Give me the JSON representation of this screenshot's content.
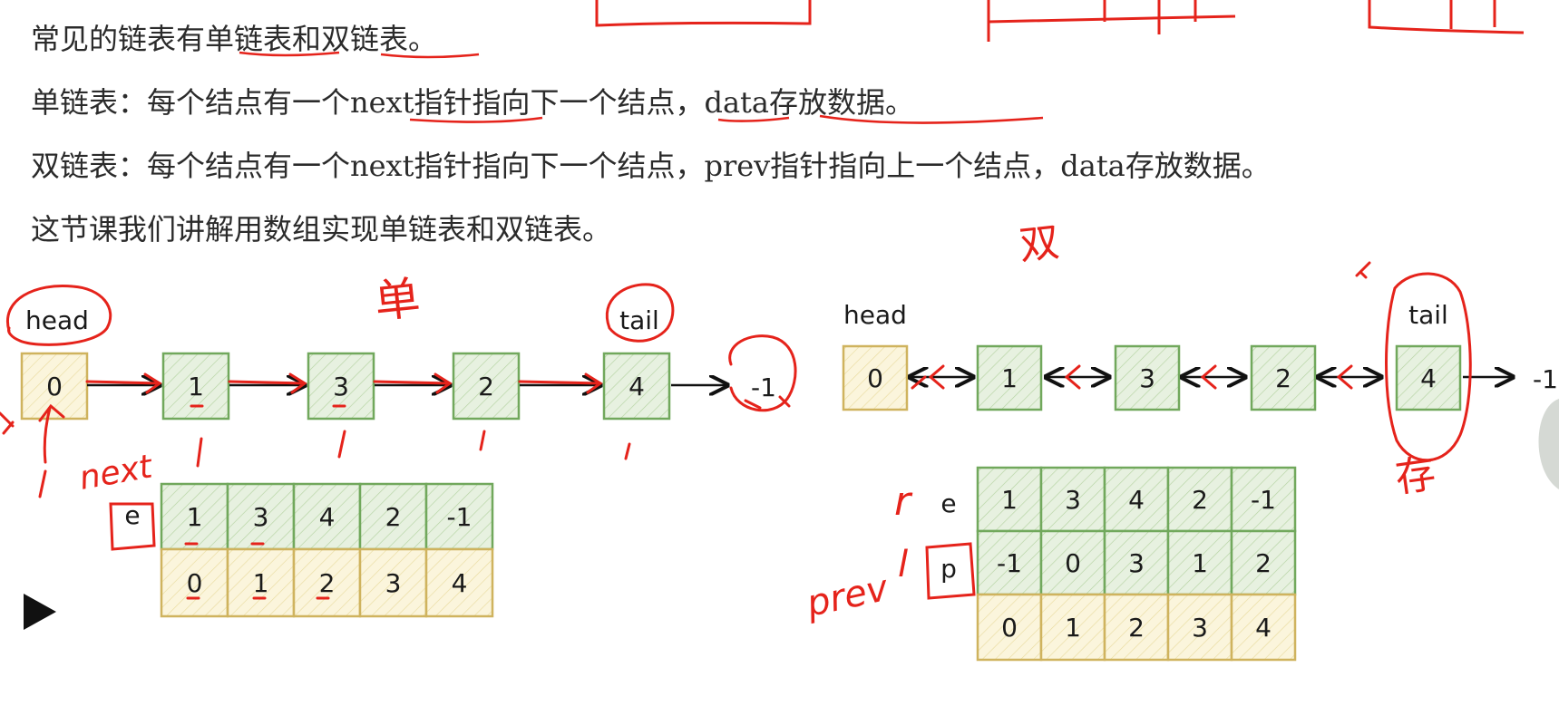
{
  "text_lines": [
    "常见的链表有单链表和双链表。",
    "单链表：每个结点有一个next指针指向下一个结点，data存放数据。",
    "双链表：每个结点有一个next指针指向下一个结点，prev指针指向上一个结点，data存放数据。",
    "这节课我们讲解用数组实现单链表和双链表。"
  ],
  "single_list": {
    "head_label": "head",
    "tail_label": "tail",
    "nodes": [
      "0",
      "1",
      "3",
      "2",
      "4"
    ],
    "null_label": "-1",
    "array_label": "e",
    "e_row": [
      "1",
      "3",
      "4",
      "2",
      "-1"
    ],
    "index_row": [
      "0",
      "1",
      "2",
      "3",
      "4"
    ]
  },
  "double_list": {
    "head_label": "head",
    "tail_label": "tail",
    "nodes": [
      "0",
      "1",
      "3",
      "2",
      "4"
    ],
    "null_label": "-1",
    "e_label": "e",
    "p_label": "p",
    "e_row": [
      "1",
      "3",
      "4",
      "2",
      "-1"
    ],
    "p_row": [
      "-1",
      "0",
      "3",
      "1",
      "2"
    ],
    "index_row": [
      "0",
      "1",
      "2",
      "3",
      "4"
    ]
  },
  "annotations": {
    "single_char": "单",
    "double_char": "双",
    "store_char": "存",
    "next_label": "next",
    "prev_label": "prev",
    "r_label": "r",
    "l_label": "l"
  },
  "colors": {
    "green_fill": "#e7f1e0",
    "green_stroke": "#71a85c",
    "yellow_fill": "#fbf5dc",
    "yellow_stroke": "#cfb35e",
    "ink_red": "#e5231b",
    "arrow_black": "#111111"
  },
  "icons": {
    "play": "play-icon"
  }
}
